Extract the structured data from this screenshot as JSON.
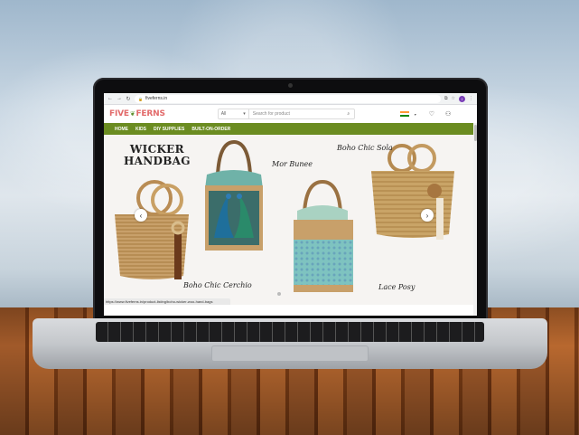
{
  "browser": {
    "url": "fiveferns.in",
    "nav_back": "←",
    "nav_forward": "→",
    "nav_reload": "↻",
    "profile_initial": "I",
    "status_url": "https://www.fiveferns.in/product-listing/boho-wicker-woo-hand-bags"
  },
  "site": {
    "logo_text": "FIVE",
    "logo_text2": "FERNS",
    "search_category": "All",
    "search_placeholder": "Search for product",
    "nav_items": [
      "HOME",
      "KIDS",
      "DIY SUPPLIES",
      "BUILT-ON-ORDER"
    ]
  },
  "banner": {
    "title_line1": "WICKER",
    "title_line2": "HANDBAG",
    "captions": [
      "Mor Bunee",
      "Boho Chic Sola",
      "Boho Chic Cerchio",
      "Lace Posy"
    ],
    "prev_arrow": "‹",
    "next_arrow": "›"
  },
  "colors": {
    "nav_bg": "#6b8c21",
    "logo": "#e26a6a",
    "wicker": "#c8a06a"
  }
}
